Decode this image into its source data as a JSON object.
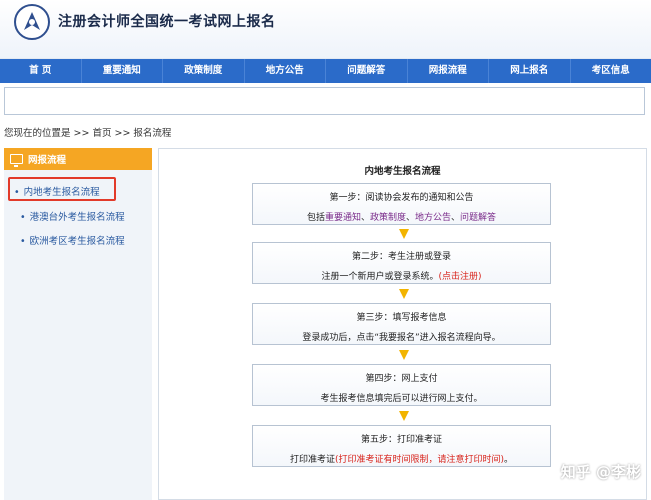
{
  "header": {
    "title": "注册会计师全国统一考试网上报名"
  },
  "nav": {
    "items": [
      "首 页",
      "重要通知",
      "政策制度",
      "地方公告",
      "问题解答",
      "网报流程",
      "网上报名",
      "考区信息"
    ]
  },
  "breadcrumb": "您现在的位置是 >> 首页 >> 报名流程",
  "sidebar": {
    "title": "网报流程",
    "items": [
      "内地考生报名流程",
      "港澳台外考生报名流程",
      "欧洲考区考生报名流程"
    ]
  },
  "main": {
    "title": "内地考生报名流程",
    "steps": [
      {
        "title": "第一步：阅读协会发布的通知和公告",
        "prefix": "包括",
        "links": [
          "重要通知",
          "政策制度",
          "地方公告",
          "问题解答"
        ],
        "sep": "、"
      },
      {
        "title": "第二步：考生注册或登录",
        "desc": "注册一个新用户或登录系统。",
        "link": "(点击注册)"
      },
      {
        "title": "第三步：填写报考信息",
        "desc": "登录成功后，点击“我要报名”进入报名流程向导。"
      },
      {
        "title": "第四步：网上支付",
        "desc": "考生报考信息填完后可以进行网上支付。"
      },
      {
        "title": "第五步：打印准考证",
        "desc": "打印准考证",
        "note": "(打印准考证有时间限制，请注意打印时间)",
        "end": "。"
      }
    ]
  },
  "watermark": "知乎 @李彬",
  "colors": {
    "nav": "#2b6bc9",
    "sidebar_header": "#f5a623",
    "arrow": "#f2b400",
    "highlight": "#e23a2a"
  }
}
